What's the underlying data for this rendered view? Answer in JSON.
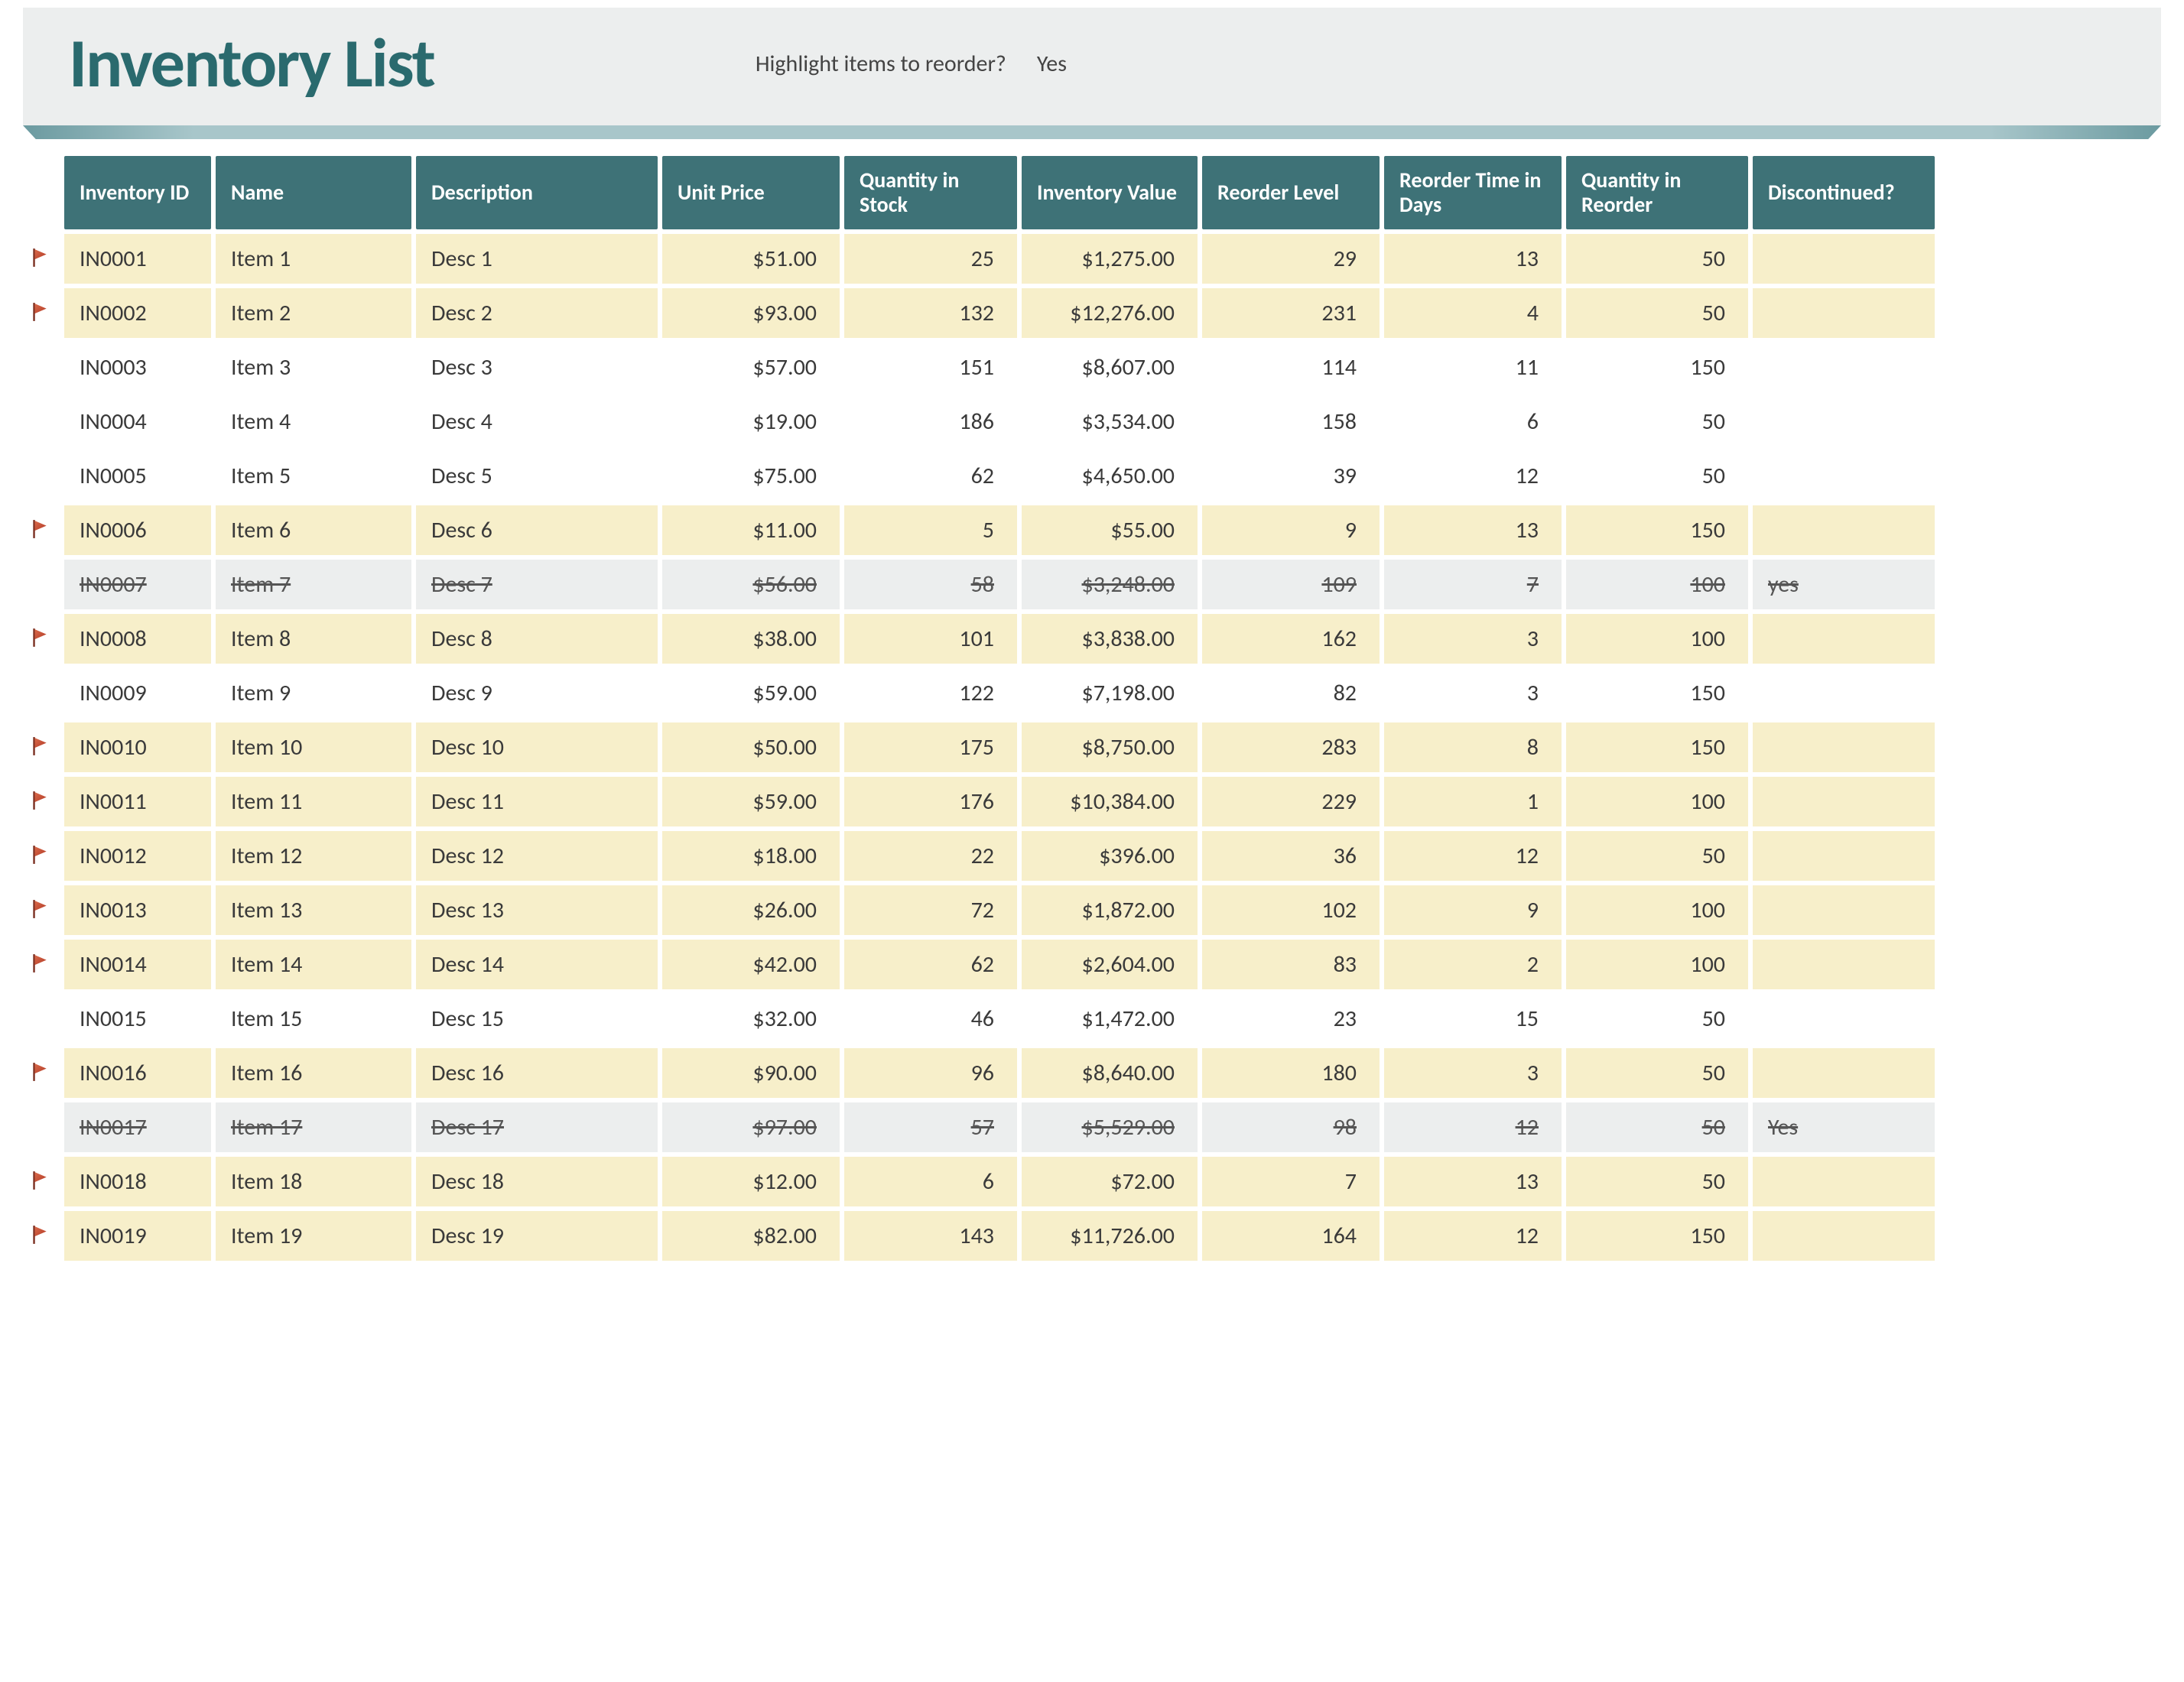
{
  "title": "Inventory List",
  "highlight_label": "Highlight items to reorder?",
  "highlight_value": "Yes",
  "columns": {
    "id": "Inventory ID",
    "name": "Name",
    "desc": "Description",
    "price": "Unit Price",
    "stock": "Quantity in Stock",
    "value": "Inventory Value",
    "reorder_level": "Reorder Level",
    "reorder_days": "Reorder Time in Days",
    "reorder_qty": "Quantity in Reorder",
    "disc": "Discontinued?"
  },
  "rows": [
    {
      "flag": true,
      "id": "IN0001",
      "name": "Item 1",
      "desc": "Desc 1",
      "price": "$51.00",
      "stock": "25",
      "value": "$1,275.00",
      "reorder_level": "29",
      "reorder_days": "13",
      "reorder_qty": "50",
      "disc": "",
      "state": "reorder"
    },
    {
      "flag": true,
      "id": "IN0002",
      "name": "Item 2",
      "desc": "Desc 2",
      "price": "$93.00",
      "stock": "132",
      "value": "$12,276.00",
      "reorder_level": "231",
      "reorder_days": "4",
      "reorder_qty": "50",
      "disc": "",
      "state": "reorder"
    },
    {
      "flag": false,
      "id": "IN0003",
      "name": "Item 3",
      "desc": "Desc 3",
      "price": "$57.00",
      "stock": "151",
      "value": "$8,607.00",
      "reorder_level": "114",
      "reorder_days": "11",
      "reorder_qty": "150",
      "disc": "",
      "state": "plain"
    },
    {
      "flag": false,
      "id": "IN0004",
      "name": "Item 4",
      "desc": "Desc 4",
      "price": "$19.00",
      "stock": "186",
      "value": "$3,534.00",
      "reorder_level": "158",
      "reorder_days": "6",
      "reorder_qty": "50",
      "disc": "",
      "state": "plain"
    },
    {
      "flag": false,
      "id": "IN0005",
      "name": "Item 5",
      "desc": "Desc 5",
      "price": "$75.00",
      "stock": "62",
      "value": "$4,650.00",
      "reorder_level": "39",
      "reorder_days": "12",
      "reorder_qty": "50",
      "disc": "",
      "state": "plain"
    },
    {
      "flag": true,
      "id": "IN0006",
      "name": "Item 6",
      "desc": "Desc 6",
      "price": "$11.00",
      "stock": "5",
      "value": "$55.00",
      "reorder_level": "9",
      "reorder_days": "13",
      "reorder_qty": "150",
      "disc": "",
      "state": "reorder"
    },
    {
      "flag": false,
      "id": "IN0007",
      "name": "Item 7",
      "desc": "Desc 7",
      "price": "$56.00",
      "stock": "58",
      "value": "$3,248.00",
      "reorder_level": "109",
      "reorder_days": "7",
      "reorder_qty": "100",
      "disc": "yes",
      "state": "discontinued"
    },
    {
      "flag": true,
      "id": "IN0008",
      "name": "Item 8",
      "desc": "Desc 8",
      "price": "$38.00",
      "stock": "101",
      "value": "$3,838.00",
      "reorder_level": "162",
      "reorder_days": "3",
      "reorder_qty": "100",
      "disc": "",
      "state": "reorder"
    },
    {
      "flag": false,
      "id": "IN0009",
      "name": "Item 9",
      "desc": "Desc 9",
      "price": "$59.00",
      "stock": "122",
      "value": "$7,198.00",
      "reorder_level": "82",
      "reorder_days": "3",
      "reorder_qty": "150",
      "disc": "",
      "state": "plain"
    },
    {
      "flag": true,
      "id": "IN0010",
      "name": "Item 10",
      "desc": "Desc 10",
      "price": "$50.00",
      "stock": "175",
      "value": "$8,750.00",
      "reorder_level": "283",
      "reorder_days": "8",
      "reorder_qty": "150",
      "disc": "",
      "state": "reorder"
    },
    {
      "flag": true,
      "id": "IN0011",
      "name": "Item 11",
      "desc": "Desc 11",
      "price": "$59.00",
      "stock": "176",
      "value": "$10,384.00",
      "reorder_level": "229",
      "reorder_days": "1",
      "reorder_qty": "100",
      "disc": "",
      "state": "reorder"
    },
    {
      "flag": true,
      "id": "IN0012",
      "name": "Item 12",
      "desc": "Desc 12",
      "price": "$18.00",
      "stock": "22",
      "value": "$396.00",
      "reorder_level": "36",
      "reorder_days": "12",
      "reorder_qty": "50",
      "disc": "",
      "state": "reorder"
    },
    {
      "flag": true,
      "id": "IN0013",
      "name": "Item 13",
      "desc": "Desc 13",
      "price": "$26.00",
      "stock": "72",
      "value": "$1,872.00",
      "reorder_level": "102",
      "reorder_days": "9",
      "reorder_qty": "100",
      "disc": "",
      "state": "reorder"
    },
    {
      "flag": true,
      "id": "IN0014",
      "name": "Item 14",
      "desc": "Desc 14",
      "price": "$42.00",
      "stock": "62",
      "value": "$2,604.00",
      "reorder_level": "83",
      "reorder_days": "2",
      "reorder_qty": "100",
      "disc": "",
      "state": "reorder"
    },
    {
      "flag": false,
      "id": "IN0015",
      "name": "Item 15",
      "desc": "Desc 15",
      "price": "$32.00",
      "stock": "46",
      "value": "$1,472.00",
      "reorder_level": "23",
      "reorder_days": "15",
      "reorder_qty": "50",
      "disc": "",
      "state": "plain"
    },
    {
      "flag": true,
      "id": "IN0016",
      "name": "Item 16",
      "desc": "Desc 16",
      "price": "$90.00",
      "stock": "96",
      "value": "$8,640.00",
      "reorder_level": "180",
      "reorder_days": "3",
      "reorder_qty": "50",
      "disc": "",
      "state": "reorder"
    },
    {
      "flag": false,
      "id": "IN0017",
      "name": "Item 17",
      "desc": "Desc 17",
      "price": "$97.00",
      "stock": "57",
      "value": "$5,529.00",
      "reorder_level": "98",
      "reorder_days": "12",
      "reorder_qty": "50",
      "disc": "Yes",
      "state": "discontinued"
    },
    {
      "flag": true,
      "id": "IN0018",
      "name": "Item 18",
      "desc": "Desc 18",
      "price": "$12.00",
      "stock": "6",
      "value": "$72.00",
      "reorder_level": "7",
      "reorder_days": "13",
      "reorder_qty": "50",
      "disc": "",
      "state": "reorder"
    },
    {
      "flag": true,
      "id": "IN0019",
      "name": "Item 19",
      "desc": "Desc 19",
      "price": "$82.00",
      "stock": "143",
      "value": "$11,726.00",
      "reorder_level": "164",
      "reorder_days": "12",
      "reorder_qty": "150",
      "disc": "",
      "state": "reorder"
    }
  ]
}
